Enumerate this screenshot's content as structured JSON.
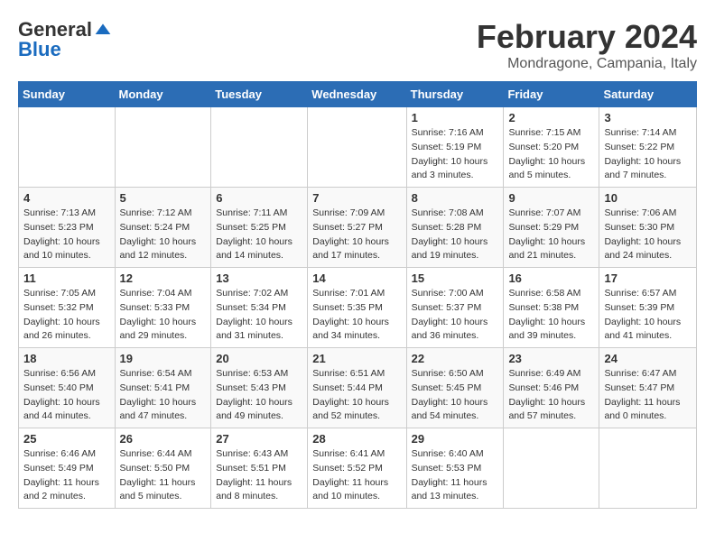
{
  "logo": {
    "general": "General",
    "blue": "Blue"
  },
  "header": {
    "month": "February 2024",
    "location": "Mondragone, Campania, Italy"
  },
  "weekdays": [
    "Sunday",
    "Monday",
    "Tuesday",
    "Wednesday",
    "Thursday",
    "Friday",
    "Saturday"
  ],
  "weeks": [
    [
      {
        "day": "",
        "info": ""
      },
      {
        "day": "",
        "info": ""
      },
      {
        "day": "",
        "info": ""
      },
      {
        "day": "",
        "info": ""
      },
      {
        "day": "1",
        "info": "Sunrise: 7:16 AM\nSunset: 5:19 PM\nDaylight: 10 hours\nand 3 minutes."
      },
      {
        "day": "2",
        "info": "Sunrise: 7:15 AM\nSunset: 5:20 PM\nDaylight: 10 hours\nand 5 minutes."
      },
      {
        "day": "3",
        "info": "Sunrise: 7:14 AM\nSunset: 5:22 PM\nDaylight: 10 hours\nand 7 minutes."
      }
    ],
    [
      {
        "day": "4",
        "info": "Sunrise: 7:13 AM\nSunset: 5:23 PM\nDaylight: 10 hours\nand 10 minutes."
      },
      {
        "day": "5",
        "info": "Sunrise: 7:12 AM\nSunset: 5:24 PM\nDaylight: 10 hours\nand 12 minutes."
      },
      {
        "day": "6",
        "info": "Sunrise: 7:11 AM\nSunset: 5:25 PM\nDaylight: 10 hours\nand 14 minutes."
      },
      {
        "day": "7",
        "info": "Sunrise: 7:09 AM\nSunset: 5:27 PM\nDaylight: 10 hours\nand 17 minutes."
      },
      {
        "day": "8",
        "info": "Sunrise: 7:08 AM\nSunset: 5:28 PM\nDaylight: 10 hours\nand 19 minutes."
      },
      {
        "day": "9",
        "info": "Sunrise: 7:07 AM\nSunset: 5:29 PM\nDaylight: 10 hours\nand 21 minutes."
      },
      {
        "day": "10",
        "info": "Sunrise: 7:06 AM\nSunset: 5:30 PM\nDaylight: 10 hours\nand 24 minutes."
      }
    ],
    [
      {
        "day": "11",
        "info": "Sunrise: 7:05 AM\nSunset: 5:32 PM\nDaylight: 10 hours\nand 26 minutes."
      },
      {
        "day": "12",
        "info": "Sunrise: 7:04 AM\nSunset: 5:33 PM\nDaylight: 10 hours\nand 29 minutes."
      },
      {
        "day": "13",
        "info": "Sunrise: 7:02 AM\nSunset: 5:34 PM\nDaylight: 10 hours\nand 31 minutes."
      },
      {
        "day": "14",
        "info": "Sunrise: 7:01 AM\nSunset: 5:35 PM\nDaylight: 10 hours\nand 34 minutes."
      },
      {
        "day": "15",
        "info": "Sunrise: 7:00 AM\nSunset: 5:37 PM\nDaylight: 10 hours\nand 36 minutes."
      },
      {
        "day": "16",
        "info": "Sunrise: 6:58 AM\nSunset: 5:38 PM\nDaylight: 10 hours\nand 39 minutes."
      },
      {
        "day": "17",
        "info": "Sunrise: 6:57 AM\nSunset: 5:39 PM\nDaylight: 10 hours\nand 41 minutes."
      }
    ],
    [
      {
        "day": "18",
        "info": "Sunrise: 6:56 AM\nSunset: 5:40 PM\nDaylight: 10 hours\nand 44 minutes."
      },
      {
        "day": "19",
        "info": "Sunrise: 6:54 AM\nSunset: 5:41 PM\nDaylight: 10 hours\nand 47 minutes."
      },
      {
        "day": "20",
        "info": "Sunrise: 6:53 AM\nSunset: 5:43 PM\nDaylight: 10 hours\nand 49 minutes."
      },
      {
        "day": "21",
        "info": "Sunrise: 6:51 AM\nSunset: 5:44 PM\nDaylight: 10 hours\nand 52 minutes."
      },
      {
        "day": "22",
        "info": "Sunrise: 6:50 AM\nSunset: 5:45 PM\nDaylight: 10 hours\nand 54 minutes."
      },
      {
        "day": "23",
        "info": "Sunrise: 6:49 AM\nSunset: 5:46 PM\nDaylight: 10 hours\nand 57 minutes."
      },
      {
        "day": "24",
        "info": "Sunrise: 6:47 AM\nSunset: 5:47 PM\nDaylight: 11 hours\nand 0 minutes."
      }
    ],
    [
      {
        "day": "25",
        "info": "Sunrise: 6:46 AM\nSunset: 5:49 PM\nDaylight: 11 hours\nand 2 minutes."
      },
      {
        "day": "26",
        "info": "Sunrise: 6:44 AM\nSunset: 5:50 PM\nDaylight: 11 hours\nand 5 minutes."
      },
      {
        "day": "27",
        "info": "Sunrise: 6:43 AM\nSunset: 5:51 PM\nDaylight: 11 hours\nand 8 minutes."
      },
      {
        "day": "28",
        "info": "Sunrise: 6:41 AM\nSunset: 5:52 PM\nDaylight: 11 hours\nand 10 minutes."
      },
      {
        "day": "29",
        "info": "Sunrise: 6:40 AM\nSunset: 5:53 PM\nDaylight: 11 hours\nand 13 minutes."
      },
      {
        "day": "",
        "info": ""
      },
      {
        "day": "",
        "info": ""
      }
    ]
  ]
}
